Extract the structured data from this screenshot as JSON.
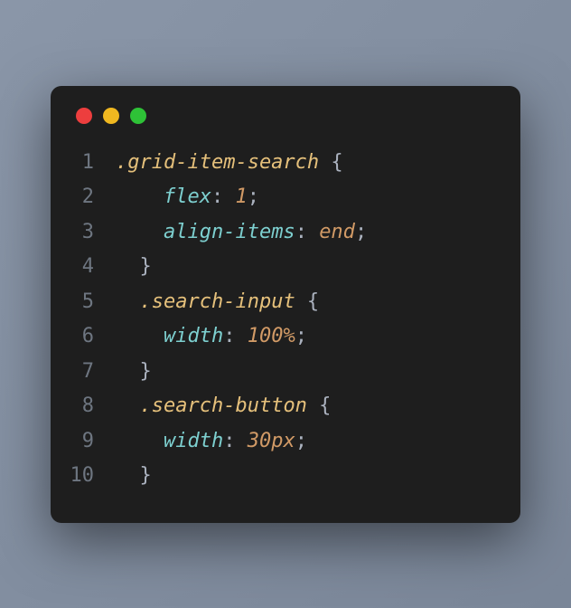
{
  "window": {
    "controls": [
      "close",
      "minimize",
      "maximize"
    ]
  },
  "code": {
    "language": "css",
    "lines": [
      {
        "n": 1,
        "tokens": [
          {
            "t": "sel",
            "v": ".grid-item-search"
          },
          {
            "t": "brace",
            "v": " {"
          }
        ]
      },
      {
        "n": 2,
        "tokens": [
          {
            "t": "plain",
            "v": "    "
          },
          {
            "t": "prop",
            "v": "flex"
          },
          {
            "t": "punct",
            "v": ": "
          },
          {
            "t": "num",
            "v": "1"
          },
          {
            "t": "punct",
            "v": ";"
          }
        ]
      },
      {
        "n": 3,
        "tokens": [
          {
            "t": "plain",
            "v": "    "
          },
          {
            "t": "prop",
            "v": "align-items"
          },
          {
            "t": "punct",
            "v": ": "
          },
          {
            "t": "val",
            "v": "end"
          },
          {
            "t": "punct",
            "v": ";"
          }
        ]
      },
      {
        "n": 4,
        "tokens": [
          {
            "t": "plain",
            "v": "  "
          },
          {
            "t": "brace",
            "v": "}"
          }
        ]
      },
      {
        "n": 5,
        "tokens": [
          {
            "t": "plain",
            "v": "  "
          },
          {
            "t": "sel",
            "v": ".search-input"
          },
          {
            "t": "brace",
            "v": " {"
          }
        ]
      },
      {
        "n": 6,
        "tokens": [
          {
            "t": "plain",
            "v": "    "
          },
          {
            "t": "prop",
            "v": "width"
          },
          {
            "t": "punct",
            "v": ": "
          },
          {
            "t": "num",
            "v": "100"
          },
          {
            "t": "unit",
            "v": "%"
          },
          {
            "t": "punct",
            "v": ";"
          }
        ]
      },
      {
        "n": 7,
        "tokens": [
          {
            "t": "plain",
            "v": "  "
          },
          {
            "t": "brace",
            "v": "}"
          }
        ]
      },
      {
        "n": 8,
        "tokens": [
          {
            "t": "plain",
            "v": "  "
          },
          {
            "t": "sel",
            "v": ".search-button"
          },
          {
            "t": "brace",
            "v": " {"
          }
        ]
      },
      {
        "n": 9,
        "tokens": [
          {
            "t": "plain",
            "v": "    "
          },
          {
            "t": "prop",
            "v": "width"
          },
          {
            "t": "punct",
            "v": ": "
          },
          {
            "t": "num",
            "v": "30"
          },
          {
            "t": "unit",
            "v": "px"
          },
          {
            "t": "punct",
            "v": ";"
          }
        ]
      },
      {
        "n": 10,
        "tokens": [
          {
            "t": "plain",
            "v": "  "
          },
          {
            "t": "brace",
            "v": "}"
          }
        ]
      }
    ]
  }
}
